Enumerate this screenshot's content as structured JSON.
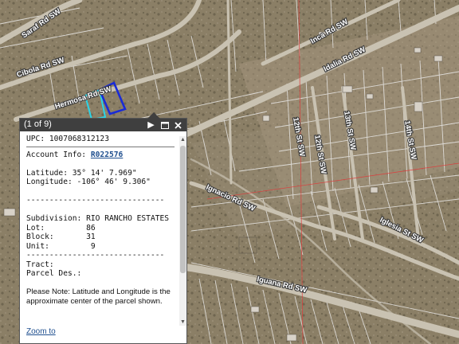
{
  "map": {
    "road_labels": [
      "Saraf Rd SW",
      "Cibola Rd SW",
      "Hermosa Rd SW",
      "Inca Rd SW",
      "Idalia Rd SW",
      "12th St SW",
      "12th St SW",
      "13th St SW",
      "14th St SW",
      "Ignacio Rd SW",
      "Iglesia St SW",
      "Iguana Rd SW"
    ],
    "colors": {
      "selected_parcel": "#1a2bd6",
      "highlight_parcel": "#2bd4e8",
      "road": "#c9c2b2",
      "parcel_line": "#efefef",
      "red_line": "#e03a3a"
    }
  },
  "popup": {
    "count": "(1 of 9)",
    "icons": [
      "triangle-right-icon",
      "maximize-icon",
      "close-icon"
    ],
    "upc": "UPC: 1007068312123",
    "account_label": "Account Info: ",
    "account_value": "R022576",
    "latitude": "Latitude: 35° 14' 7.969\"",
    "longitude": "Longitude: -106° 46' 9.306\"",
    "dashes": "------------------------------",
    "subdivision": "Subdivision: RIO RANCHO ESTATES",
    "lot": "Lot:         86",
    "block": "Block:       31",
    "unit": "Unit:         9",
    "tract": "Tract:",
    "parcel_des": "Parcel Des.:",
    "note": "Please Note: Latitude and Longitude is the approximate center of the parcel shown.",
    "zoom_to": "Zoom to"
  }
}
